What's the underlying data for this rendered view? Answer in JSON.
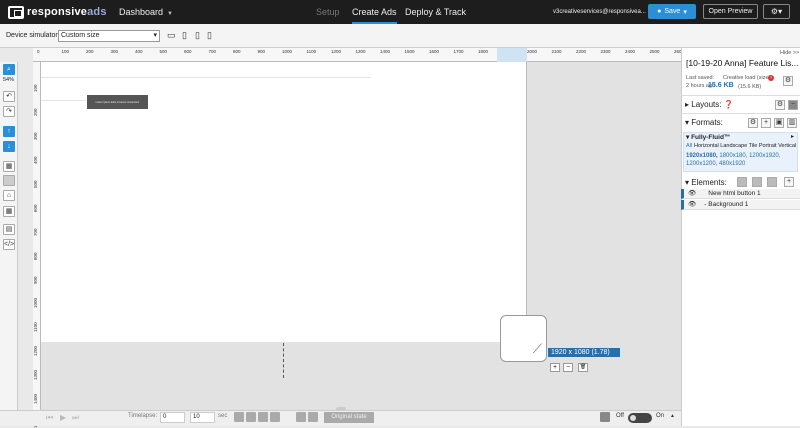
{
  "header": {
    "logo_main": "responsive",
    "logo_accent": "ads",
    "dashboard": "Dashboard",
    "tabs": [
      "Setup",
      "Create Ads",
      "Deploy & Track"
    ],
    "account": "v3creativeservices@responsivea...",
    "save": "Save",
    "open_preview": "Open Preview",
    "gear": "⚙",
    "caret": "▾"
  },
  "device": {
    "label": "Device simulator",
    "value": "Custom size",
    "icons": [
      "▭",
      "▯",
      "▯",
      "▯"
    ]
  },
  "ruler": {
    "h": [
      "0",
      "100",
      "200",
      "300",
      "400",
      "500",
      "600",
      "700",
      "800",
      "900",
      "1000",
      "1100",
      "1200",
      "1300",
      "1400",
      "1500",
      "1600",
      "1700",
      "1800",
      "1900",
      "2000",
      "2100",
      "2200",
      "2300",
      "2400",
      "2500",
      "2600"
    ],
    "v": [
      "100",
      "200",
      "300",
      "400",
      "500",
      "600",
      "700",
      "800",
      "900",
      "1000",
      "1100",
      "1200",
      "1300",
      "1400",
      "1500"
    ]
  },
  "tools": {
    "zoom": "54%"
  },
  "canvas": {
    "element_text": "Lorem ipsum dolor sit amet consectetur",
    "dims": "1920  x 1080   (1.78)",
    "plus": "+",
    "minus": "−",
    "trash": "🗑"
  },
  "bottom": {
    "timelapse": "Timelapse:",
    "t_from": "0",
    "t_to": "10",
    "sec": "sec",
    "original": "Original state",
    "off": "Off",
    "on": "On",
    "up": "▲"
  },
  "panel": {
    "hide": "Hide >>",
    "title": "[10-19-20 Anna] Feature Lis...",
    "last_saved_label": "Last saved:",
    "last_saved_value": "2 hours ago",
    "creative_load_label": "Creative load (size):",
    "creative_load_value": "15.6 KB",
    "creative_load_sub": "(15.6 KB)",
    "layouts": "Layouts:",
    "formats": "Formats:",
    "format_name": "Fully-Fluid™",
    "format_all": "All",
    "format_kinds": "Horizontal Landscape Tile Portrait Vertical",
    "format_sizes_bold": "1920x1080,",
    "format_sizes": "1800x180, 1200x1920, 1200x1200, 480x1920",
    "elements": "Elements:",
    "element_items": [
      "New html button 1",
      "Background 1"
    ]
  },
  "colors": {
    "accent": "#2a8fd6",
    "dark": "#1d1d1d"
  }
}
